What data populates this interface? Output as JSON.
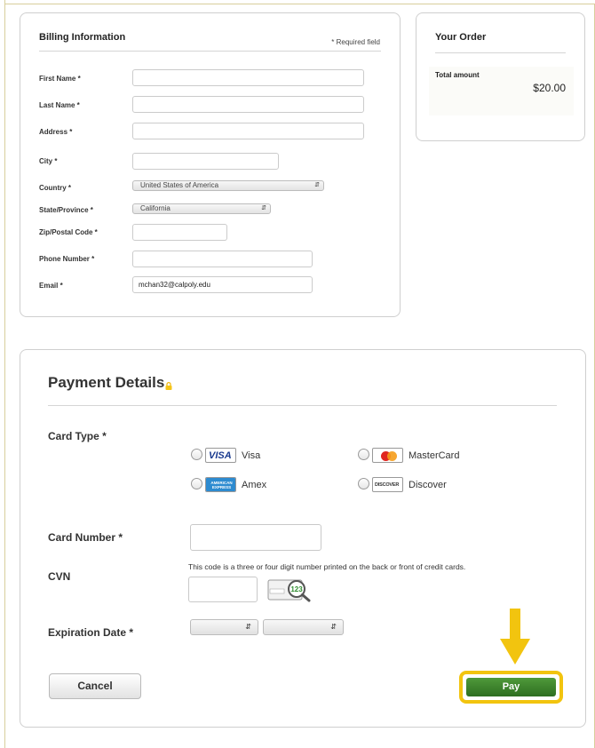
{
  "billing": {
    "title": "Billing Information",
    "required_note": "* Required field",
    "fields": {
      "first_name": {
        "label": "First Name *",
        "value": ""
      },
      "last_name": {
        "label": "Last Name *",
        "value": ""
      },
      "address": {
        "label": "Address *",
        "value": ""
      },
      "city": {
        "label": "City *",
        "value": ""
      },
      "country": {
        "label": "Country *",
        "value": "United States of America"
      },
      "state": {
        "label": "State/Province *",
        "value": "California"
      },
      "zip": {
        "label": "Zip/Postal Code *",
        "value": ""
      },
      "phone": {
        "label": "Phone Number *",
        "value": ""
      },
      "email": {
        "label": "Email *",
        "value": "mchan32@calpoly.edu"
      }
    }
  },
  "order": {
    "title": "Your Order",
    "total_label": "Total amount",
    "total_amount": "$20.00"
  },
  "payment": {
    "title": "Payment Details",
    "card_type_label": "Card Type *",
    "card_options": [
      {
        "name": "Visa",
        "icon": "visa-logo-icon",
        "logo_text": "VISA"
      },
      {
        "name": "MasterCard",
        "icon": "mastercard-logo-icon"
      },
      {
        "name": "Amex",
        "icon": "amex-logo-icon",
        "logo_text": "AMERICAN EXPRESS"
      },
      {
        "name": "Discover",
        "icon": "discover-logo-icon",
        "logo_text": "DISCOVER"
      }
    ],
    "card_number_label": "Card Number *",
    "cvn_label": "CVN",
    "cvn_hint": "This code is a three or four digit number printed on the back or front of credit cards.",
    "cvn_icon_text": "123",
    "expiration_label": "Expiration Date *",
    "cancel_label": "Cancel",
    "pay_label": "Pay"
  },
  "colors": {
    "pay_button": "#3d8a2e",
    "highlight": "#f2c40f",
    "frame": "#d8ce9c"
  }
}
